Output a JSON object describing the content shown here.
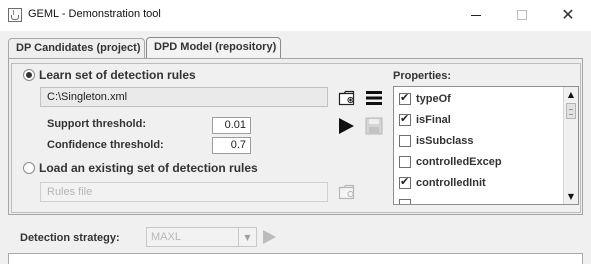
{
  "window": {
    "title": "GEML - Demonstration tool"
  },
  "tabs": [
    {
      "label": "DP Candidates (project)"
    },
    {
      "label": "DPD Model (repository)"
    }
  ],
  "learn": {
    "label": "Learn set of detection rules",
    "file_value": "C:\\Singleton.xml",
    "support_label": "Support threshold:",
    "support_value": "0.01",
    "confidence_label": "Confidence threshold:",
    "confidence_value": "0.7"
  },
  "load": {
    "label": "Load an existing set of detection rules",
    "file_placeholder": "Rules file"
  },
  "properties": {
    "label": "Properties:",
    "items": [
      {
        "label": "typeOf",
        "checked": true
      },
      {
        "label": "isFinal",
        "checked": true
      },
      {
        "label": "isSubclass",
        "checked": false
      },
      {
        "label": "controlledExcep",
        "checked": false
      },
      {
        "label": "controlledInit",
        "checked": true
      }
    ]
  },
  "detection": {
    "label": "Detection strategy:",
    "value": "MAXL"
  },
  "icons": {
    "play": "play-icon",
    "save": "save-icon",
    "open": "open-file-icon",
    "menu": "menu-icon"
  }
}
